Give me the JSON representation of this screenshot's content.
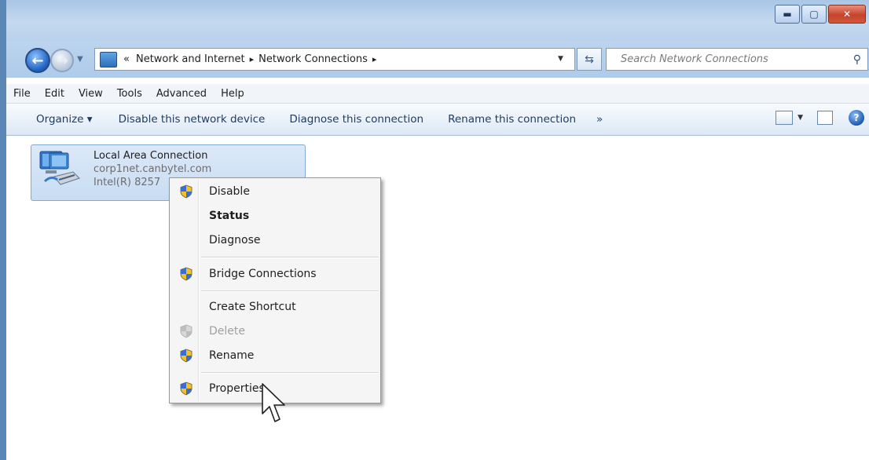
{
  "address_bar": {
    "breadcrumb_prefix": "«",
    "crumb1": "Network and Internet",
    "crumb2": "Network Connections",
    "separator": "▸",
    "search_placeholder": "Search Network Connections"
  },
  "menu": [
    "File",
    "Edit",
    "View",
    "Tools",
    "Advanced",
    "Help"
  ],
  "commands": {
    "organize": "Organize ▾",
    "disable": "Disable this network device",
    "diagnose": "Diagnose this connection",
    "rename": "Rename this connection",
    "more": "»"
  },
  "connection": {
    "title": "Local Area Connection",
    "domain": "corp1net.canbytel.com",
    "adapter": "Intel(R) 8257"
  },
  "context_menu": {
    "disable": "Disable",
    "status": "Status",
    "diagnose": "Diagnose",
    "bridge": "Bridge Connections",
    "shortcut": "Create Shortcut",
    "delete": "Delete",
    "rename": "Rename",
    "properties": "Properties"
  },
  "icons": {
    "shield_colors": [
      "#3a6fd1",
      "#f2c12e"
    ],
    "help": "?"
  }
}
